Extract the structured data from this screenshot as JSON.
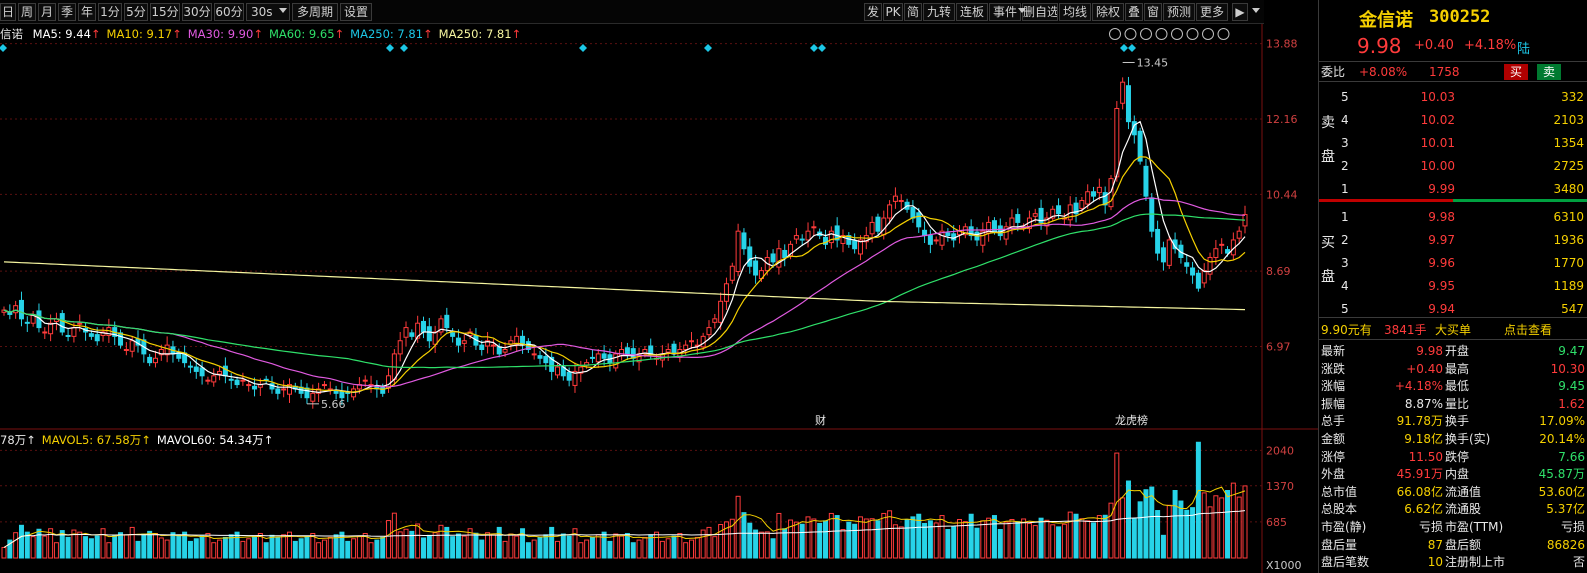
{
  "toolbar": {
    "left": [
      "日",
      "周",
      "月",
      "季",
      "年",
      "1分",
      "5分",
      "15分",
      "30分",
      "60分"
    ],
    "dropdown": "30s",
    "multi": "多周期",
    "settings": "设置",
    "right": [
      "发",
      "PK",
      "简",
      "九转",
      "连板",
      "事件",
      "删自选",
      "均线",
      "除权",
      "叠",
      "窗",
      "预测",
      "更多"
    ]
  },
  "ma_legend": {
    "name": "信诺",
    "items": [
      {
        "label": "MA5: 9.44",
        "color": "#ffffff"
      },
      {
        "label": "MA10: 9.17",
        "color": "#f5d000"
      },
      {
        "label": "MA30: 9.90",
        "color": "#e05ae0"
      },
      {
        "label": "MA60: 9.65",
        "color": "#2fe06a"
      },
      {
        "label": "MA250: 7.81",
        "color": "#1cc7e6"
      },
      {
        "label": "MA250: 7.81",
        "color": "#f5f5a0"
      }
    ],
    "arrow": "↑"
  },
  "vol_legend": {
    "items": [
      {
        "label": "78万↑",
        "color": "#e8e8e8"
      },
      {
        "label": "MAVOL5: 67.58万↑",
        "color": "#f5d000"
      },
      {
        "label": "MAVOL60: 54.34万↑",
        "color": "#ffffff"
      }
    ]
  },
  "price_axis": [
    "13.88",
    "12.16",
    "10.44",
    "8.69",
    "6.97"
  ],
  "vol_axis": [
    "2040",
    "1370",
    "685",
    "X1000"
  ],
  "annotations": {
    "high": "13.45",
    "low": "5.66",
    "marker1": "财",
    "marker2": "龙虎榜"
  },
  "stock": {
    "name": "金信诺",
    "code": "300252",
    "price": "9.98",
    "change": "+0.40",
    "pct": "+4.18%",
    "tag": "陆"
  },
  "weibi": {
    "label": "委比",
    "value": "+8.08%",
    "diff": "1758",
    "buy_btn": "买",
    "sell_btn": "卖"
  },
  "sell_label": [
    "卖",
    "盘"
  ],
  "buy_label": [
    "买",
    "盘"
  ],
  "asks": [
    {
      "level": "5",
      "price": "10.03",
      "vol": "332"
    },
    {
      "level": "4",
      "price": "10.02",
      "vol": "2103"
    },
    {
      "level": "3",
      "price": "10.01",
      "vol": "1354"
    },
    {
      "level": "2",
      "price": "10.00",
      "vol": "2725"
    },
    {
      "level": "1",
      "price": "9.99",
      "vol": "3480"
    }
  ],
  "bids": [
    {
      "level": "1",
      "price": "9.98",
      "vol": "6310"
    },
    {
      "level": "2",
      "price": "9.97",
      "vol": "1936"
    },
    {
      "level": "3",
      "price": "9.96",
      "vol": "1770"
    },
    {
      "level": "4",
      "price": "9.95",
      "vol": "1189"
    },
    {
      "level": "5",
      "price": "9.94",
      "vol": "547"
    }
  ],
  "bigorder": {
    "price": "9.90元有",
    "qty": "3841手",
    "label": "大买单",
    "link": "点击查看"
  },
  "stats": [
    {
      "k1": "最新",
      "v1": "9.98",
      "c1": "red",
      "k2": "开盘",
      "v2": "9.47",
      "c2": "grn"
    },
    {
      "k1": "涨跌",
      "v1": "+0.40",
      "c1": "red",
      "k2": "最高",
      "v2": "10.30",
      "c2": "red"
    },
    {
      "k1": "涨幅",
      "v1": "+4.18%",
      "c1": "red",
      "k2": "最低",
      "v2": "9.45",
      "c2": "grn"
    },
    {
      "k1": "振幅",
      "v1": "8.87%",
      "c1": "wht",
      "k2": "量比",
      "v2": "1.62",
      "c2": "red"
    },
    {
      "k1": "总手",
      "v1": "91.78万",
      "c1": "yel",
      "k2": "换手",
      "v2": "17.09%",
      "c2": "yel"
    },
    {
      "k1": "金额",
      "v1": "9.18亿",
      "c1": "yel",
      "k2": "换手(实)",
      "v2": "20.14%",
      "c2": "yel"
    },
    {
      "k1": "涨停",
      "v1": "11.50",
      "c1": "red",
      "k2": "跌停",
      "v2": "7.66",
      "c2": "grn"
    },
    {
      "k1": "外盘",
      "v1": "45.91万",
      "c1": "red",
      "k2": "内盘",
      "v2": "45.87万",
      "c2": "grn"
    },
    {
      "k1": "总市值",
      "v1": "66.08亿",
      "c1": "yel",
      "k2": "流通值",
      "v2": "53.60亿",
      "c2": "yel"
    },
    {
      "k1": "总股本",
      "v1": "6.62亿",
      "c1": "yel",
      "k2": "流通股",
      "v2": "5.37亿",
      "c2": "yel"
    },
    {
      "k1": "市盈(静)",
      "v1": "亏损",
      "c1": "wht",
      "k2": "市盈(TTM)",
      "v2": "亏损",
      "c2": "wht"
    },
    {
      "k1": "盘后量",
      "v1": "87",
      "c1": "yel",
      "k2": "盘后额",
      "v2": "86826",
      "c2": "yel"
    },
    {
      "k1": "盘后笔数",
      "v1": "10",
      "c1": "yel",
      "k2": "注册制上市",
      "v2": "否",
      "c2": "wht"
    }
  ],
  "chart_data": {
    "type": "candlestick",
    "price_ticks": [
      13.88,
      12.16,
      10.44,
      8.69,
      6.97
    ],
    "volume_ticks": [
      2040,
      1370,
      685
    ],
    "volume_unit": "X1000",
    "high_label": 13.45,
    "low_label": 5.66,
    "closes": [
      7.8,
      7.7,
      7.9,
      7.6,
      7.5,
      7.7,
      7.4,
      7.3,
      7.5,
      7.6,
      7.3,
      7.2,
      7.4,
      7.5,
      7.3,
      7.2,
      7.1,
      7.3,
      7.4,
      7.2,
      7.0,
      6.9,
      7.1,
      7.0,
      6.8,
      6.6,
      6.7,
      6.9,
      7.0,
      6.8,
      6.7,
      6.6,
      6.5,
      6.4,
      6.3,
      6.2,
      6.3,
      6.4,
      6.3,
      6.2,
      6.1,
      6.2,
      6.1,
      6.0,
      6.1,
      6.2,
      6.0,
      5.9,
      6.0,
      6.1,
      6.0,
      5.9,
      5.8,
      5.9,
      6.0,
      6.1,
      6.0,
      5.9,
      5.8,
      5.9,
      6.0,
      6.1,
      6.2,
      6.1,
      6.0,
      5.9,
      6.3,
      6.8,
      7.1,
      7.4,
      7.2,
      7.5,
      7.3,
      7.1,
      7.3,
      7.6,
      7.4,
      7.2,
      7.0,
      7.1,
      7.3,
      7.0,
      6.9,
      7.1,
      7.0,
      6.8,
      6.9,
      7.1,
      7.2,
      7.0,
      6.9,
      6.8,
      6.7,
      6.6,
      6.4,
      6.5,
      6.3,
      6.2,
      6.4,
      6.5,
      6.6,
      6.7,
      6.8,
      6.7,
      6.6,
      6.8,
      6.9,
      6.8,
      6.7,
      6.8,
      6.9,
      6.8,
      6.7,
      6.8,
      6.9,
      6.8,
      6.9,
      7.0,
      7.1,
      7.0,
      7.2,
      7.4,
      7.6,
      8.0,
      8.4,
      8.8,
      9.6,
      9.2,
      8.8,
      8.6,
      8.7,
      9.0,
      8.9,
      9.2,
      9.0,
      9.3,
      9.5,
      9.4,
      9.6,
      9.7,
      9.5,
      9.3,
      9.6,
      9.4,
      9.5,
      9.3,
      9.2,
      9.4,
      9.5,
      9.8,
      9.6,
      9.9,
      10.2,
      10.4,
      10.3,
      10.1,
      9.9,
      9.7,
      9.5,
      9.3,
      9.4,
      9.6,
      9.5,
      9.4,
      9.6,
      9.7,
      9.5,
      9.4,
      9.6,
      9.8,
      9.6,
      9.5,
      9.7,
      9.9,
      9.8,
      9.7,
      9.9,
      10.0,
      9.8,
      9.9,
      10.1,
      10.0,
      9.9,
      10.2,
      10.0,
      10.3,
      10.5,
      10.4,
      10.6,
      10.2,
      10.8,
      12.4,
      13.0,
      12.1,
      11.8,
      11.2,
      10.4,
      9.6,
      9.1,
      8.9,
      9.4,
      9.2,
      9.0,
      8.8,
      8.6,
      8.3,
      8.7,
      9.0,
      9.2,
      9.3,
      9.1,
      9.4,
      9.6,
      9.98
    ],
    "ma5": 9.44,
    "ma10": 9.17,
    "ma30": 9.9,
    "ma60": 9.65,
    "ma250": 7.81,
    "mavol5": "67.58万",
    "mavol60": "54.34万"
  }
}
